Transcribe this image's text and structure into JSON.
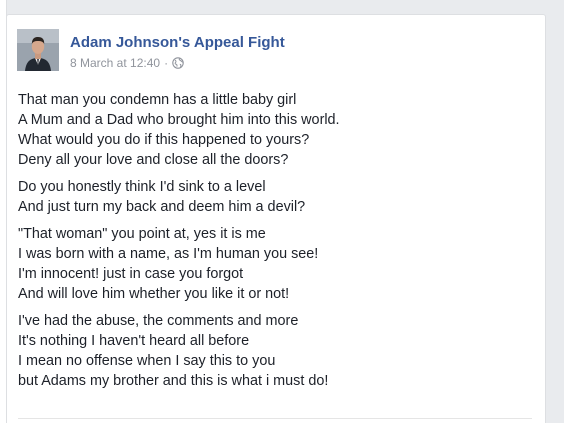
{
  "post": {
    "author": "Adam Johnson's Appeal Fight",
    "timestamp": "8 March at 12:40",
    "separator": "·",
    "privacy_icon": "globe-icon",
    "stanzas": [
      {
        "lines": [
          "That man you condemn has a little baby girl",
          "A Mum and a Dad who brought him into this world.",
          "What would you do if this happened to yours?",
          "Deny all your love and close all the doors?"
        ]
      },
      {
        "lines": [
          "Do you honestly think I'd sink to a level",
          "And just turn my back and deem him a devil?"
        ]
      },
      {
        "lines": [
          "\"That woman\" you point at, yes it is me",
          "I was born with a name, as I'm human you see!",
          "I'm innocent! just in case you forgot",
          "And will love him whether you like it or not!"
        ]
      },
      {
        "lines": [
          "I've had the abuse, the comments and more",
          "It's nothing I haven't heard all before",
          "I mean no offense when I say this to you",
          "but Adams my brother and this is what i must do!"
        ]
      }
    ]
  },
  "colors": {
    "page_background": "#e9ebee",
    "card_background": "#ffffff",
    "author_link": "#365899",
    "meta_text": "#90949c",
    "body_text": "#1d2129"
  }
}
